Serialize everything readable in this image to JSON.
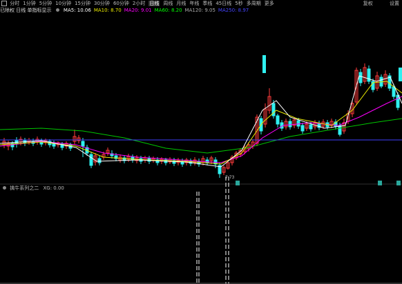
{
  "toolbar": {
    "window_icon": "window-icon",
    "periods": [
      "分时",
      "1分钟",
      "5分钟",
      "10分钟",
      "15分钟",
      "30分钟",
      "60分钟",
      "2小时",
      "日线",
      "周线",
      "月线",
      "年线",
      "季线",
      "45日线",
      "5秒",
      "多周期",
      "更多"
    ],
    "active_index": 8,
    "right": [
      "复权",
      "设置"
    ]
  },
  "ma_line": {
    "title": "已除权 日线 单指标显示",
    "items": [
      {
        "label": "MA5: 10.06",
        "color": "#ffffff"
      },
      {
        "label": "MA10: 8.70",
        "color": "#e8e800"
      },
      {
        "label": "MA20: 9.01",
        "color": "#ff00ff"
      },
      {
        "label": "MA60: 8.20",
        "color": "#00ff00"
      },
      {
        "label": "MA120: 9.05",
        "color": "#aaaaaa"
      },
      {
        "label": "MA250: 8.97",
        "color": "#4444ff"
      }
    ]
  },
  "chart": {
    "low_label": "7.73",
    "colors": {
      "up": "#ff3b3b",
      "down": "#2ff0f0",
      "ma5": "#ffffff",
      "ma10": "#e8e800",
      "ma20": "#ff00ff",
      "ma60": "#00c800",
      "ma250": "#4040ff"
    }
  },
  "indicator": {
    "title": "擒牛系列之二",
    "value": "XG: 0.00"
  }
}
